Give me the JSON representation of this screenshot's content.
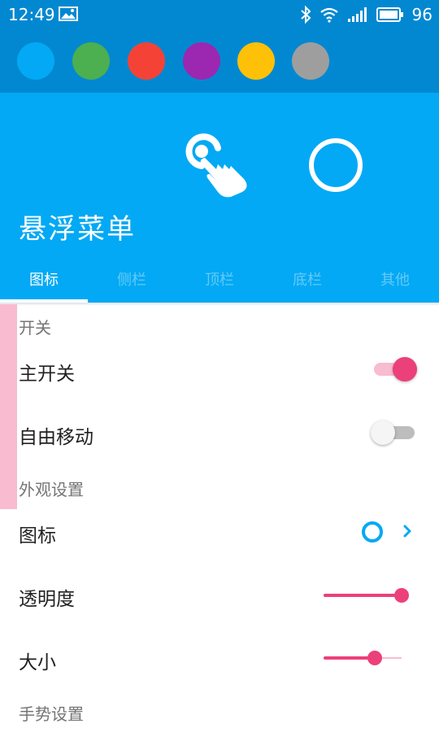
{
  "status_bar": {
    "time": "12:49",
    "battery": "96",
    "icons": [
      "image-icon",
      "bluetooth-icon",
      "wifi-icon",
      "signal-icon",
      "battery-icon"
    ]
  },
  "palette": {
    "colors": [
      "#03a9f4",
      "#4caf50",
      "#f44336",
      "#9c27b0",
      "#ffc107",
      "#9e9e9e"
    ]
  },
  "hero": {
    "title": "悬浮菜单",
    "icons": [
      "touch-hand-icon",
      "ring-preview-icon"
    ]
  },
  "tabs": [
    "图标",
    "侧栏",
    "顶栏",
    "底栏",
    "其他"
  ],
  "active_tab": 0,
  "sections": {
    "switch_header": "开关",
    "appearance_header": "外观设置",
    "gesture_header": "手势设置"
  },
  "settings": {
    "master_switch": {
      "label": "主开关",
      "on": true
    },
    "free_move": {
      "label": "自由移动",
      "on": false
    },
    "icon": {
      "label": "图标"
    },
    "opacity": {
      "label": "透明度",
      "value": 1.0
    },
    "size": {
      "label": "大小",
      "value": 0.66
    }
  },
  "colors": {
    "primary_dark": "#0288d1",
    "primary": "#03a9f4",
    "accent": "#ec407a",
    "accent_light": "#f8bbd0"
  }
}
